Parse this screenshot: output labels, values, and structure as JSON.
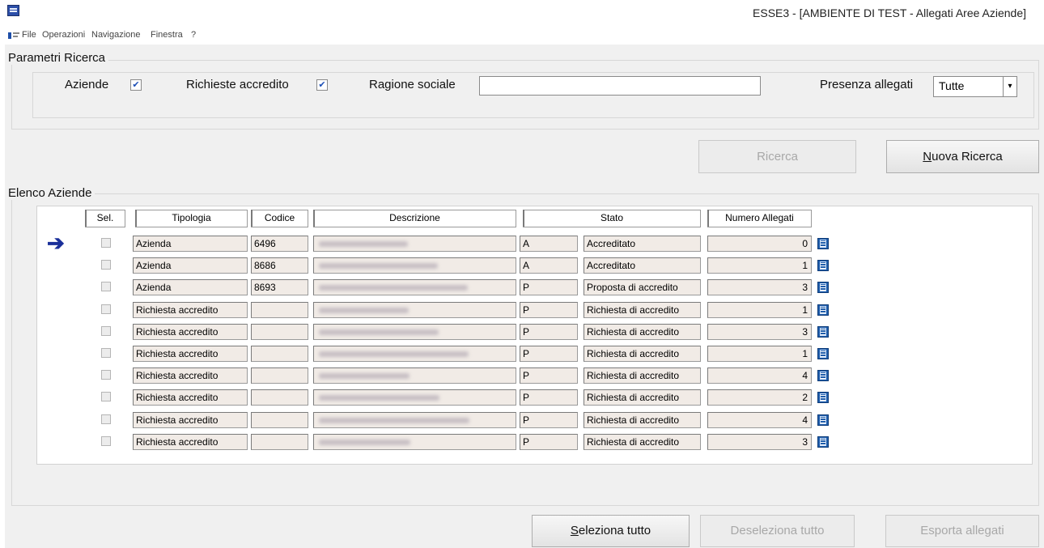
{
  "window": {
    "title": "ESSE3 - [AMBIENTE DI TEST - Allegati Aree Aziende]"
  },
  "menu": [
    "File",
    "Operazioni",
    "Navigazione",
    "Finestra",
    "?"
  ],
  "search": {
    "group_title": "Parametri Ricerca",
    "aziende_label": "Aziende",
    "aziende_checked": true,
    "richieste_label": "Richieste accredito",
    "richieste_checked": true,
    "ragione_label": "Ragione sociale",
    "ragione_value": "",
    "presenza_label": "Presenza allegati",
    "presenza_value": "Tutte"
  },
  "buttons": {
    "ricerca": "Ricerca",
    "nuova_ricerca": "Nuova Ricerca",
    "seleziona_tutto": "Seleziona tutto",
    "deseleziona_tutto": "Deseleziona tutto",
    "esporta_allegati": "Esporta allegati"
  },
  "list": {
    "group_title": "Elenco Aziende",
    "columns": [
      "Sel.",
      "Tipologia",
      "Codice",
      "Descrizione",
      "Stato",
      "Numero Allegati"
    ],
    "rows": [
      {
        "tipologia": "Azienda",
        "codice": "6496",
        "stato_code": "A",
        "stato": "Accreditato",
        "allegati": "0"
      },
      {
        "tipologia": "Azienda",
        "codice": "8686",
        "stato_code": "A",
        "stato": "Accreditato",
        "allegati": "1"
      },
      {
        "tipologia": "Azienda",
        "codice": "8693",
        "stato_code": "P",
        "stato": "Proposta di accredito",
        "allegati": "3"
      },
      {
        "tipologia": "Richiesta accredito",
        "codice": "",
        "stato_code": "P",
        "stato": "Richiesta di accredito",
        "allegati": "1"
      },
      {
        "tipologia": "Richiesta accredito",
        "codice": "",
        "stato_code": "P",
        "stato": "Richiesta di accredito",
        "allegati": "3"
      },
      {
        "tipologia": "Richiesta accredito",
        "codice": "",
        "stato_code": "P",
        "stato": "Richiesta di accredito",
        "allegati": "1"
      },
      {
        "tipologia": "Richiesta accredito",
        "codice": "",
        "stato_code": "P",
        "stato": "Richiesta di accredito",
        "allegati": "4"
      },
      {
        "tipologia": "Richiesta accredito",
        "codice": "",
        "stato_code": "P",
        "stato": "Richiesta di accredito",
        "allegati": "2"
      },
      {
        "tipologia": "Richiesta accredito",
        "codice": "",
        "stato_code": "P",
        "stato": "Richiesta di accredito",
        "allegati": "4"
      },
      {
        "tipologia": "Richiesta accredito",
        "codice": "",
        "stato_code": "P",
        "stato": "Richiesta di accredito",
        "allegati": "3"
      }
    ]
  },
  "icons": {
    "app": "app-icon",
    "menu": "window-menu-icon",
    "current_row": "current-row-arrow-icon",
    "detail": "detail-icon",
    "dropdown": "chevron-down-icon"
  }
}
